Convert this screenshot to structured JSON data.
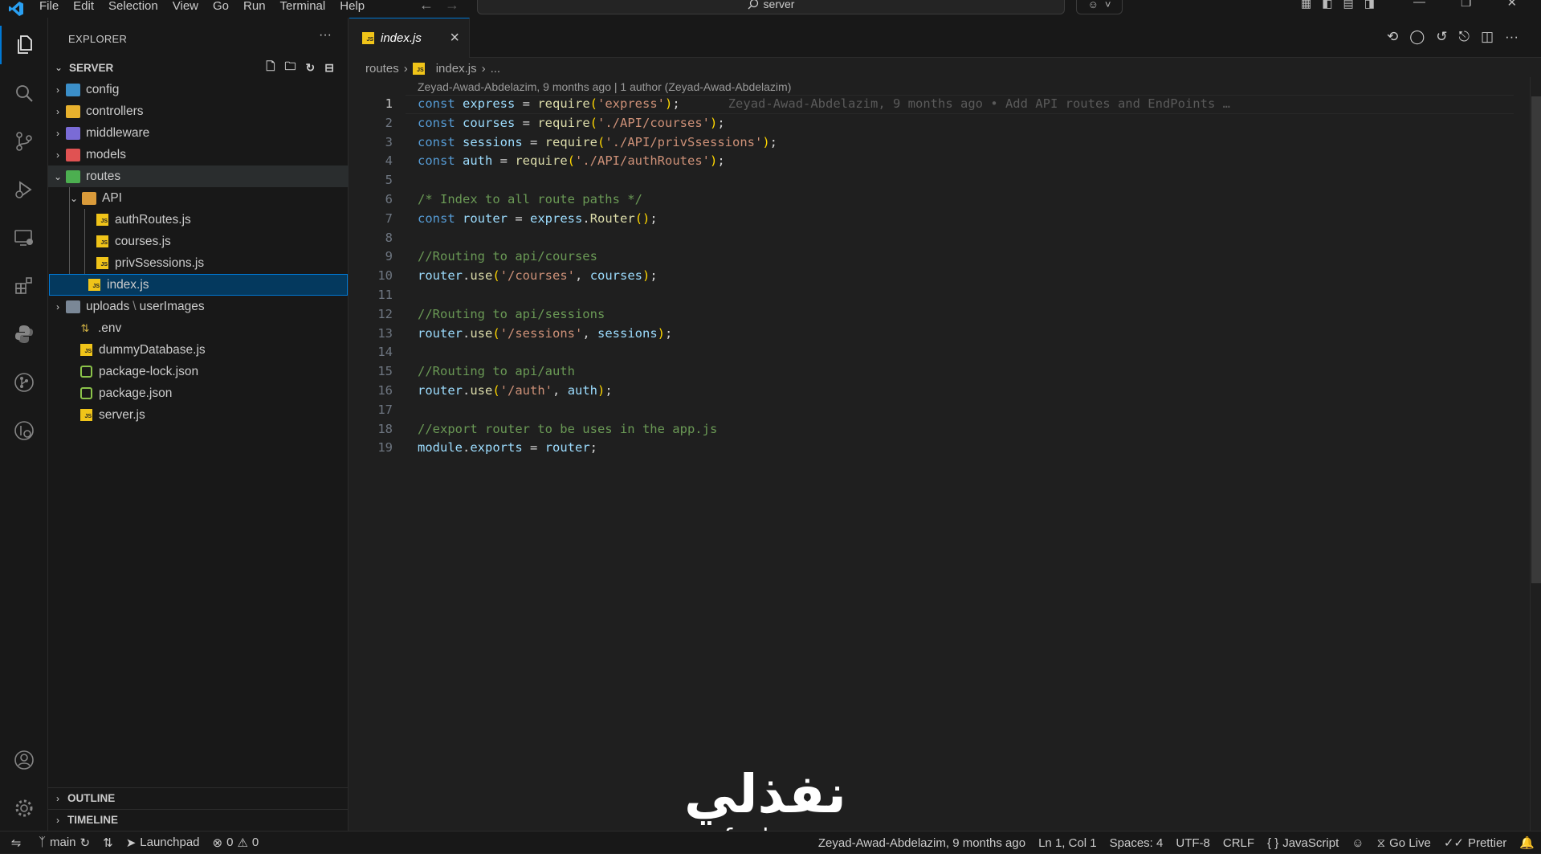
{
  "menu": [
    "File",
    "Edit",
    "Selection",
    "View",
    "Go",
    "Run",
    "Terminal",
    "Help"
  ],
  "search": {
    "label": "server"
  },
  "sidebar": {
    "title": "EXPLORER",
    "root": "SERVER",
    "tree": {
      "config": "config",
      "controllers": "controllers",
      "middleware": "middleware",
      "models": "models",
      "routes": "routes",
      "api": "API",
      "authRoutes": "authRoutes.js",
      "courses": "courses.js",
      "privSsessions": "privSsessions.js",
      "index": "index.js",
      "uploads": "uploads",
      "uploadsSep": "\\",
      "userImages": "userImages",
      "env": ".env",
      "dummyDatabase": "dummyDatabase.js",
      "packageLock": "package-lock.json",
      "package": "package.json",
      "server": "server.js"
    },
    "outline": "OUTLINE",
    "timeline": "TIMELINE"
  },
  "editor": {
    "tab": "index.js",
    "breadcrumb": {
      "folder": "routes",
      "file": "index.js",
      "more": "..."
    },
    "blame_header": "Zeyad-Awad-Abdelazim, 9 months ago | 1 author (Zeyad-Awad-Abdelazim)",
    "inline_blame": "Zeyad-Awad-Abdelazim, 9 months ago • Add API routes and EndPoints …",
    "line_numbers": [
      "1",
      "2",
      "3",
      "4",
      "5",
      "6",
      "7",
      "8",
      "9",
      "10",
      "11",
      "12",
      "13",
      "14",
      "15",
      "16",
      "17",
      "18",
      "19"
    ],
    "code": {
      "l1": {
        "kw": "const",
        "var": "express",
        "eq": " = ",
        "fn": "require",
        "str": "'express'",
        "end": ";"
      },
      "l2": {
        "kw": "const",
        "var": "courses",
        "eq": " = ",
        "fn": "require",
        "str": "'./API/courses'",
        "end": ";"
      },
      "l3": {
        "kw": "const",
        "var": "sessions",
        "eq": " = ",
        "fn": "require",
        "str": "'./API/privSsessions'",
        "end": ";"
      },
      "l4": {
        "kw": "const",
        "var": "auth",
        "eq": " = ",
        "fn": "require",
        "str": "'./API/authRoutes'",
        "end": ";"
      },
      "l6": "/* Index to all route paths */",
      "l7": {
        "kw": "const",
        "var": "router",
        "eq": " = ",
        "obj": "express",
        "fn": "Router",
        "end": ";"
      },
      "l9": "//Routing to api/courses",
      "l10": {
        "obj": "router",
        "fn": "use",
        "str": "'/courses'",
        "arg": "courses",
        "end": ";"
      },
      "l12": "//Routing to api/sessions",
      "l13": {
        "obj": "router",
        "fn": "use",
        "str": "'/sessions'",
        "arg": "sessions",
        "end": ";"
      },
      "l15": "//Routing to api/auth",
      "l16": {
        "obj": "router",
        "fn": "use",
        "str": "'/auth'",
        "arg": "auth",
        "end": ";"
      },
      "l18": "//export router to be uses in the app.js",
      "l19": {
        "obj": "module",
        "prop": "exports",
        "eq": " = ",
        "arg": "router",
        "end": ";"
      }
    }
  },
  "watermark": {
    "arabic": "نفذلي",
    "latin": "nafezly.com"
  },
  "status": {
    "branch": "main",
    "launchpad": "Launchpad",
    "errors": "0",
    "warnings": "0",
    "blame": "Zeyad-Awad-Abdelazim, 9 months ago",
    "position": "Ln 1, Col 1",
    "spaces": "Spaces: 4",
    "encoding": "UTF-8",
    "eol": "CRLF",
    "language": "JavaScript",
    "golive": "Go Live",
    "prettier": "Prettier"
  },
  "colors": {
    "accent": "#0078d4",
    "selection": "#04395e",
    "background": "#1f1f1f",
    "sidebar": "#181818"
  }
}
